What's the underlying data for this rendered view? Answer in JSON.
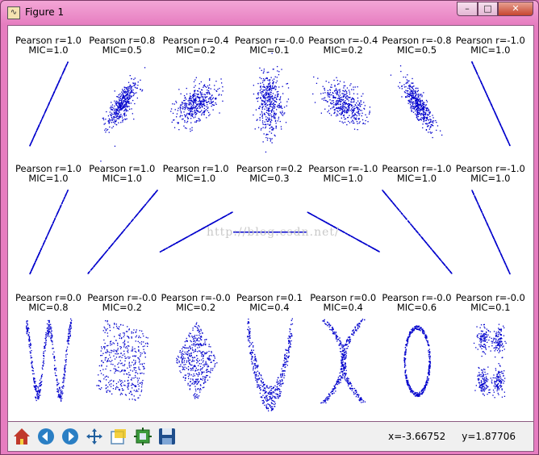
{
  "window": {
    "title": "Figure 1",
    "app_icon": "matplotlib-icon"
  },
  "controls": {
    "minimize": "minimize-icon",
    "maximize": "maximize-icon",
    "close": "close-icon"
  },
  "figure": {
    "watermark": "http://blog.csdn.net/",
    "point_color": "#0000cc",
    "rows": [
      [
        {
          "pearson": "Pearson r=1.0",
          "mic": "MIC=1.0",
          "shape": "line",
          "slope": 2.2,
          "noise": 0
        },
        {
          "pearson": "Pearson r=0.8",
          "mic": "MIC=0.5",
          "shape": "blob",
          "slope": 1.3,
          "noise": 0.35
        },
        {
          "pearson": "Pearson r=0.4",
          "mic": "MIC=0.2",
          "shape": "blob",
          "slope": 0.5,
          "noise": 0.55
        },
        {
          "pearson": "Pearson r=-0.0",
          "mic": "MIC=0.1",
          "shape": "blob",
          "slope": 0,
          "noise": 0.6
        },
        {
          "pearson": "Pearson r=-0.4",
          "mic": "MIC=0.2",
          "shape": "blob",
          "slope": -0.5,
          "noise": 0.55
        },
        {
          "pearson": "Pearson r=-0.8",
          "mic": "MIC=0.5",
          "shape": "blob",
          "slope": -1.3,
          "noise": 0.35
        },
        {
          "pearson": "Pearson r=-1.0",
          "mic": "MIC=1.0",
          "shape": "line",
          "slope": -2.2,
          "noise": 0
        }
      ],
      [
        {
          "pearson": "Pearson r=1.0",
          "mic": "MIC=1.0",
          "shape": "line",
          "slope": 2.2,
          "noise": 0
        },
        {
          "pearson": "Pearson r=1.0",
          "mic": "MIC=1.0",
          "shape": "line",
          "slope": 1.2,
          "noise": 0
        },
        {
          "pearson": "Pearson r=1.0",
          "mic": "MIC=1.0",
          "shape": "line",
          "slope": 0.55,
          "noise": 0
        },
        {
          "pearson": "Pearson r=0.2",
          "mic": "MIC=0.3",
          "shape": "line",
          "slope": 0.0,
          "noise": 0
        },
        {
          "pearson": "Pearson r=-1.0",
          "mic": "MIC=1.0",
          "shape": "line",
          "slope": -0.55,
          "noise": 0
        },
        {
          "pearson": "Pearson r=-1.0",
          "mic": "MIC=1.0",
          "shape": "line",
          "slope": -1.2,
          "noise": 0
        },
        {
          "pearson": "Pearson r=-1.0",
          "mic": "MIC=1.0",
          "shape": "line",
          "slope": -2.2,
          "noise": 0
        }
      ],
      [
        {
          "pearson": "Pearson r=0.0",
          "mic": "MIC=0.8",
          "shape": "w",
          "slope": 0,
          "noise": 0
        },
        {
          "pearson": "Pearson r=-0.0",
          "mic": "MIC=0.2",
          "shape": "square",
          "slope": 0,
          "noise": 0
        },
        {
          "pearson": "Pearson r=-0.0",
          "mic": "MIC=0.2",
          "shape": "diamond",
          "slope": 0,
          "noise": 0
        },
        {
          "pearson": "Pearson r=0.1",
          "mic": "MIC=0.4",
          "shape": "parabola",
          "slope": 0,
          "noise": 0
        },
        {
          "pearson": "Pearson r=0.0",
          "mic": "MIC=0.4",
          "shape": "x",
          "slope": 0,
          "noise": 0
        },
        {
          "pearson": "Pearson r=-0.0",
          "mic": "MIC=0.6",
          "shape": "ring",
          "slope": 0,
          "noise": 0
        },
        {
          "pearson": "Pearson r=-0.0",
          "mic": "MIC=0.1",
          "shape": "clusters",
          "slope": 0,
          "noise": 0
        }
      ]
    ]
  },
  "toolbar": {
    "buttons": [
      "home-icon",
      "back-icon",
      "forward-icon",
      "pan-icon",
      "zoom-icon",
      "subplots-icon",
      "save-icon"
    ],
    "x_readout": "x=-3.66752",
    "y_readout": "y=1.87706"
  }
}
